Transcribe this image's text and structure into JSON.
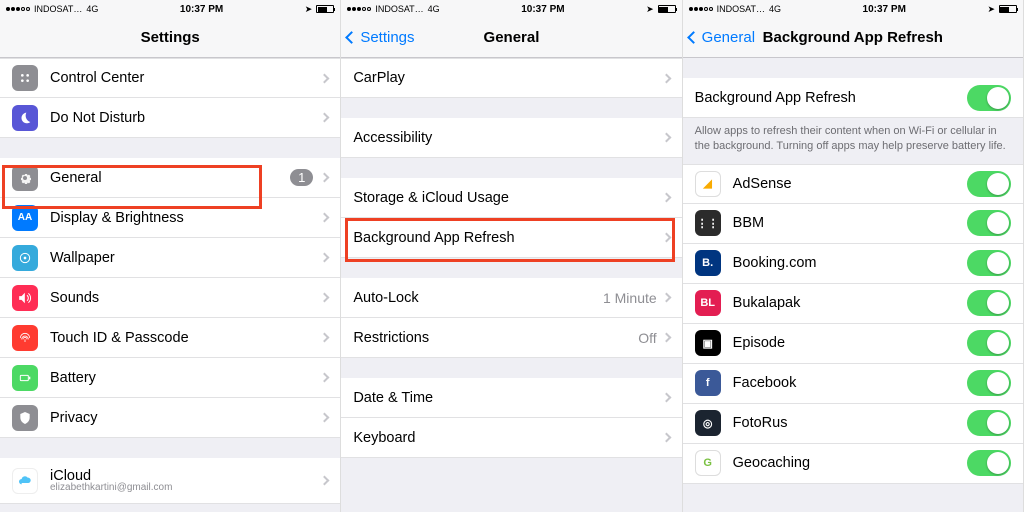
{
  "status": {
    "carrier": "INDOSAT…",
    "network": "4G",
    "time": "10:37 PM"
  },
  "screen1": {
    "title": "Settings",
    "rows": [
      {
        "label": "Control Center",
        "iconColor": "#8e8e93"
      },
      {
        "label": "Do Not Disturb",
        "iconColor": "#5856d6"
      }
    ],
    "rows2": [
      {
        "label": "General",
        "iconColor": "#8e8e93",
        "badge": "1",
        "highlighted": true
      },
      {
        "label": "Display & Brightness",
        "iconColor": "#007aff",
        "iconText": "AA"
      },
      {
        "label": "Wallpaper",
        "iconColor": "#55c1f0"
      },
      {
        "label": "Sounds",
        "iconColor": "#ff2d55"
      },
      {
        "label": "Touch ID & Passcode",
        "iconColor": "#ff3b30"
      },
      {
        "label": "Battery",
        "iconColor": "#4cd964"
      },
      {
        "label": "Privacy",
        "iconColor": "#8e8e93"
      }
    ],
    "rows3": [
      {
        "label": "iCloud",
        "sub": "elizabethkartini@gmail.com",
        "iconColor": "#ffffff"
      }
    ]
  },
  "screen2": {
    "back": "Settings",
    "title": "General",
    "group1": [
      {
        "label": "CarPlay"
      }
    ],
    "group2": [
      {
        "label": "Accessibility"
      }
    ],
    "group3": [
      {
        "label": "Storage & iCloud Usage"
      },
      {
        "label": "Background App Refresh",
        "highlighted": true
      }
    ],
    "group4": [
      {
        "label": "Auto-Lock",
        "detail": "1 Minute"
      },
      {
        "label": "Restrictions",
        "detail": "Off"
      }
    ],
    "group5": [
      {
        "label": "Date & Time"
      },
      {
        "label": "Keyboard"
      }
    ]
  },
  "screen3": {
    "back": "General",
    "title": "Background App Refresh",
    "master": {
      "label": "Background App Refresh"
    },
    "note": "Allow apps to refresh their content when on Wi-Fi or cellular in the background. Turning off apps may help preserve battery life.",
    "apps": [
      {
        "label": "AdSense",
        "bg": "#fff",
        "fg": "#f9ab00",
        "text": "◢"
      },
      {
        "label": "BBM",
        "bg": "#2b2b2b",
        "text": "⋮⋮"
      },
      {
        "label": "Booking.com",
        "bg": "#003580",
        "text": "B."
      },
      {
        "label": "Bukalapak",
        "bg": "#e31e52",
        "text": "BL"
      },
      {
        "label": "Episode",
        "bg": "#000",
        "text": "▣"
      },
      {
        "label": "Facebook",
        "bg": "#3b5998",
        "text": "f"
      },
      {
        "label": "FotoRus",
        "bg": "#1b2430",
        "text": "◎"
      },
      {
        "label": "Geocaching",
        "bg": "#fff",
        "fg": "#7ac142",
        "text": "G"
      }
    ]
  }
}
